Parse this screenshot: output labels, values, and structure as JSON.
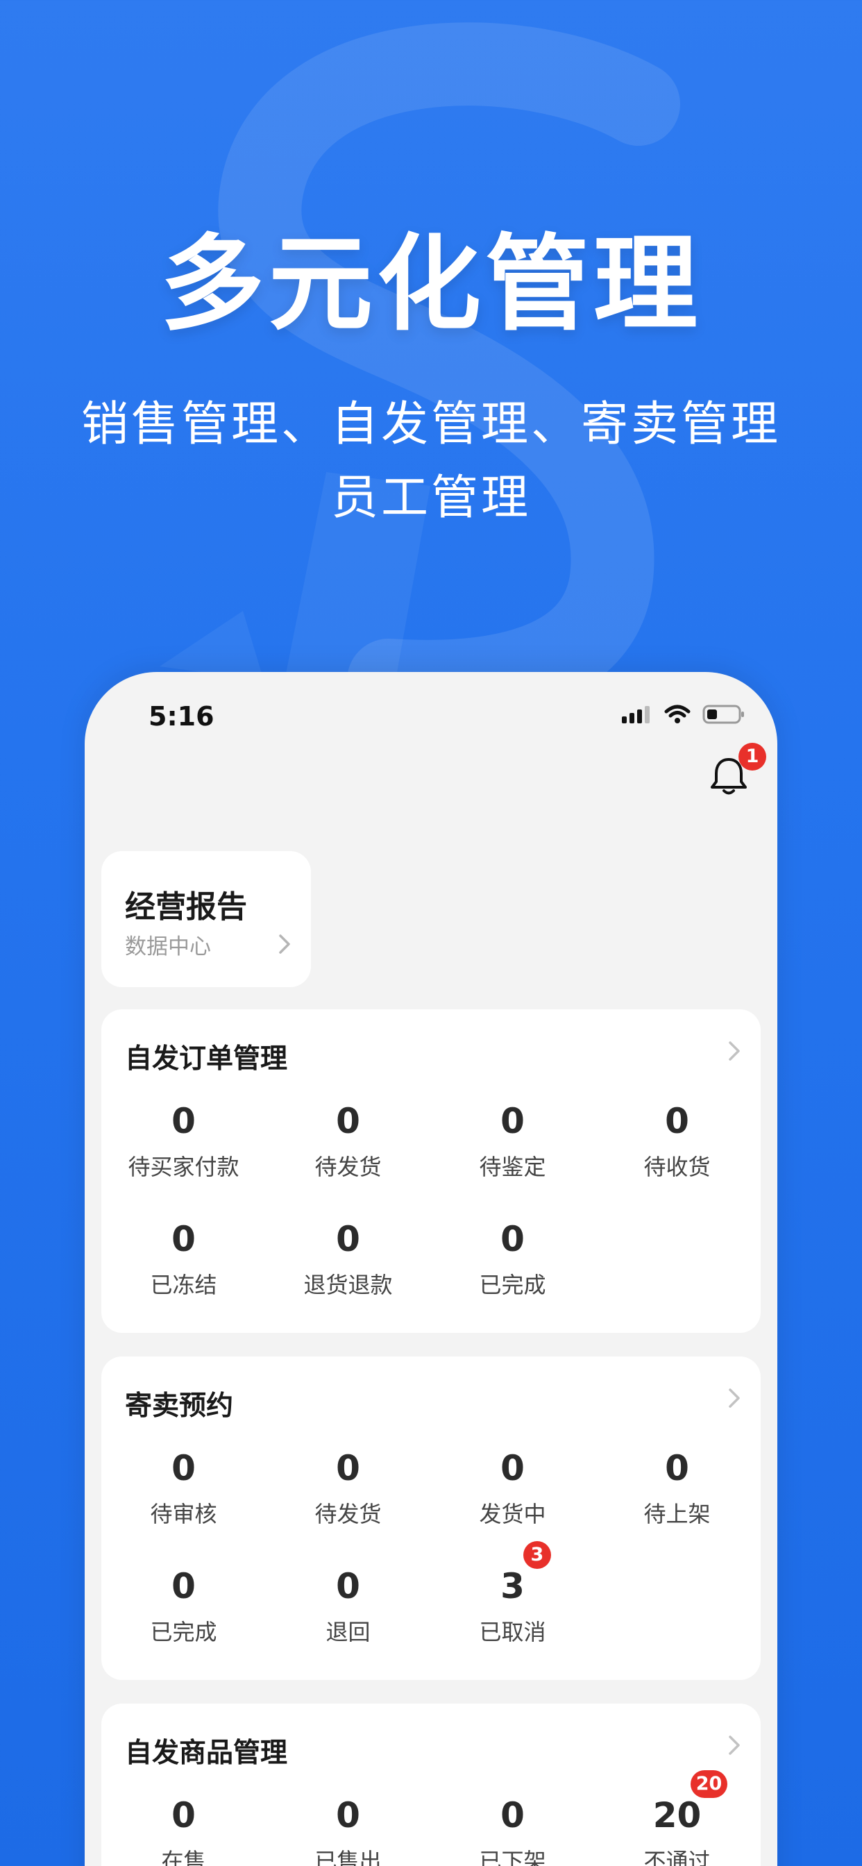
{
  "promo": {
    "headline": "多元化管理",
    "subtitle_line1": "销售管理、自发管理、寄卖管理",
    "subtitle_line2": "员工管理"
  },
  "status_bar": {
    "time": "5:16",
    "icons": [
      "signal-icon",
      "wifi-icon",
      "battery-icon"
    ]
  },
  "notifications": {
    "icon": "bell-icon",
    "count": "1"
  },
  "report": {
    "title": "经营报告",
    "subtitle": "数据中心"
  },
  "sections": [
    {
      "title": "自发订单管理",
      "items": [
        {
          "value": "0",
          "label": "待买家付款"
        },
        {
          "value": "0",
          "label": "待发货"
        },
        {
          "value": "0",
          "label": "待鉴定"
        },
        {
          "value": "0",
          "label": "待收货"
        },
        {
          "value": "0",
          "label": "已冻结"
        },
        {
          "value": "0",
          "label": "退货退款"
        },
        {
          "value": "0",
          "label": "已完成"
        }
      ]
    },
    {
      "title": "寄卖预约",
      "items": [
        {
          "value": "0",
          "label": "待审核"
        },
        {
          "value": "0",
          "label": "待发货"
        },
        {
          "value": "0",
          "label": "发货中"
        },
        {
          "value": "0",
          "label": "待上架"
        },
        {
          "value": "0",
          "label": "已完成"
        },
        {
          "value": "0",
          "label": "退回"
        },
        {
          "value": "3",
          "label": "已取消",
          "badge": "3"
        }
      ]
    },
    {
      "title": "自发商品管理",
      "items": [
        {
          "value": "0",
          "label": "在售"
        },
        {
          "value": "0",
          "label": "已售出"
        },
        {
          "value": "0",
          "label": "已下架"
        },
        {
          "value": "20",
          "label": "不通过",
          "badge": "20"
        }
      ]
    }
  ],
  "colors": {
    "background": "#2574ee",
    "badge": "#e8302a",
    "card": "#ffffff",
    "phone_bg": "#f3f3f3"
  }
}
